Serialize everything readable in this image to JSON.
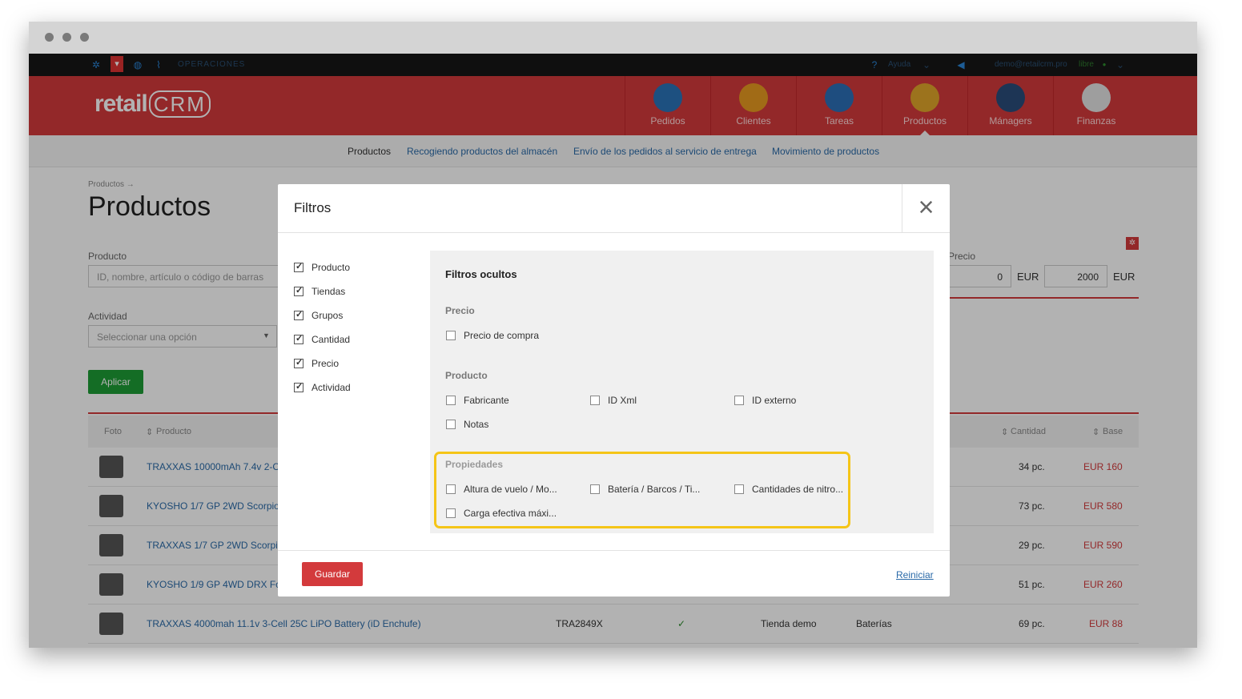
{
  "topbar": {
    "operations": "OPERACIONES",
    "help": "Ayuda",
    "user_email": "demo@retailcrm.pro",
    "user_status": "libre"
  },
  "logo": {
    "retail": "retail",
    "crm": "CRM"
  },
  "nav": [
    {
      "label": "Pedidos",
      "icon": "cart-icon",
      "color": "#2a73b8"
    },
    {
      "label": "Clientes",
      "icon": "person-icon",
      "color": "#e79a20"
    },
    {
      "label": "Tareas",
      "icon": "list-icon",
      "color": "#2b6fb6"
    },
    {
      "label": "Productos",
      "icon": "box-icon",
      "color": "#e0a52a"
    },
    {
      "label": "Managers",
      "icon": "manager-icon",
      "color": "#2a4d7a"
    },
    {
      "label": "Finanzas",
      "icon": "finance-icon",
      "color": "#e3e3e3"
    }
  ],
  "nav_display": {
    "managers_label": "Mánagers"
  },
  "subnav": {
    "productos": "Productos",
    "recogiendo": "Recogiendo productos del almacén",
    "envio": "Envío de los pedidos al servicio de entrega",
    "movimiento": "Movimiento de productos"
  },
  "page": {
    "breadcrumb": "Productos →",
    "title": "Productos",
    "product_label": "Producto",
    "product_placeholder": "ID, nombre, artículo o código de barras",
    "activity_label": "Actividad",
    "activity_placeholder": "Seleccionar una opción",
    "apply": "Aplicar",
    "price_label": "Precio",
    "price_min": "0",
    "price_max": "2000",
    "currency": "EUR"
  },
  "table": {
    "headers": {
      "foto": "Foto",
      "producto": "Producto",
      "cantidad": "Cantidad",
      "base": "Base"
    },
    "rows": [
      {
        "name": "TRAXXAS 10000mAh 7.4v 2-C",
        "qty": "34 pc.",
        "price": "EUR 160"
      },
      {
        "name": "KYOSHO 1/7 GP 2WD Scorpio",
        "qty": "73 pc.",
        "price": "EUR 580"
      },
      {
        "name": "TRAXXAS 1/7 GP 2WD Scorpi",
        "qty": "29 pc.",
        "price": "EUR 590"
      },
      {
        "name": "KYOSHO 1/9 GP 4WD DRX Fo",
        "qty": "51 pc.",
        "price": "EUR 260"
      },
      {
        "name": "TRAXXAS 4000mah 11.1v 3-Cell 25C LiPO Battery (iD Enchufe)",
        "sku": "TRA2849X",
        "check": "✓",
        "store": "Tienda demo",
        "group": "Baterías",
        "qty": "69 pc.",
        "price": "EUR 88"
      }
    ]
  },
  "modal": {
    "title": "Filtros",
    "active_filters": [
      {
        "label": "Producto",
        "checked": true
      },
      {
        "label": "Tiendas",
        "checked": true
      },
      {
        "label": "Grupos",
        "checked": true
      },
      {
        "label": "Cantidad",
        "checked": true
      },
      {
        "label": "Precio",
        "checked": true
      },
      {
        "label": "Actividad",
        "checked": true
      }
    ],
    "hidden_title": "Filtros ocultos",
    "sections": {
      "precio": {
        "title": "Precio",
        "items": [
          "Precio de compra"
        ]
      },
      "producto": {
        "title": "Producto",
        "items": [
          "Fabricante",
          "ID Xml",
          "ID externo",
          "Notas"
        ]
      },
      "propiedades": {
        "title": "Propiedades",
        "items": [
          "Altura de vuelo / Mo...",
          "Batería / Barcos / Ti...",
          "Cantidades de nitro...",
          "Carga efectiva máxi..."
        ]
      }
    },
    "save": "Guardar",
    "reset": "Reiniciar"
  },
  "colors": {
    "brand_red": "#d33a3c",
    "highlight": "#f5c518",
    "apply_green": "#1d9c35",
    "link_blue": "#2a6aa8"
  }
}
